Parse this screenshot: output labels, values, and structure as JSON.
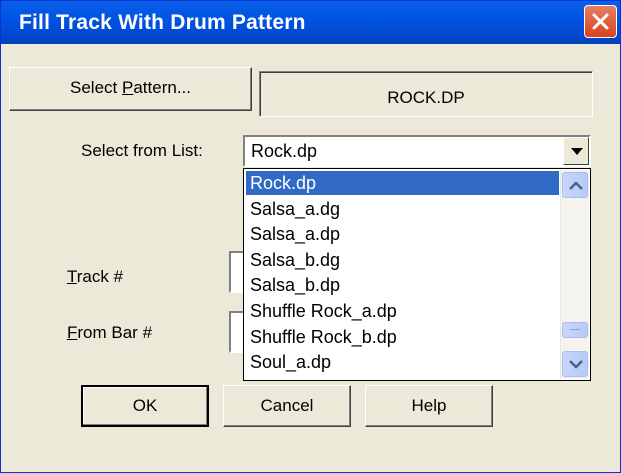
{
  "window": {
    "title": "Fill Track With Drum Pattern"
  },
  "pattern": {
    "select_button": "Select Pattern...",
    "select_button_mnemonic": "P",
    "current": "ROCK.DP"
  },
  "list_select": {
    "label": "Select from List:",
    "value": "Rock.dp"
  },
  "dropdown": {
    "items": [
      "Rock.dp",
      "Salsa_a.dg",
      "Salsa_a.dp",
      "Salsa_b.dg",
      "Salsa_b.dp",
      "Shuffle Rock_a.dp",
      "Shuffle Rock_b.dp",
      "Soul_a.dp"
    ],
    "selected_index": 0
  },
  "fields": {
    "track_label": "Track #",
    "from_bar_label": "From Bar #"
  },
  "buttons": {
    "ok": "OK",
    "cancel": "Cancel",
    "help": "Help"
  },
  "colors": {
    "titlebar": "#0054e3",
    "selection": "#316ac5",
    "dialog_bg": "#ece9d8"
  }
}
